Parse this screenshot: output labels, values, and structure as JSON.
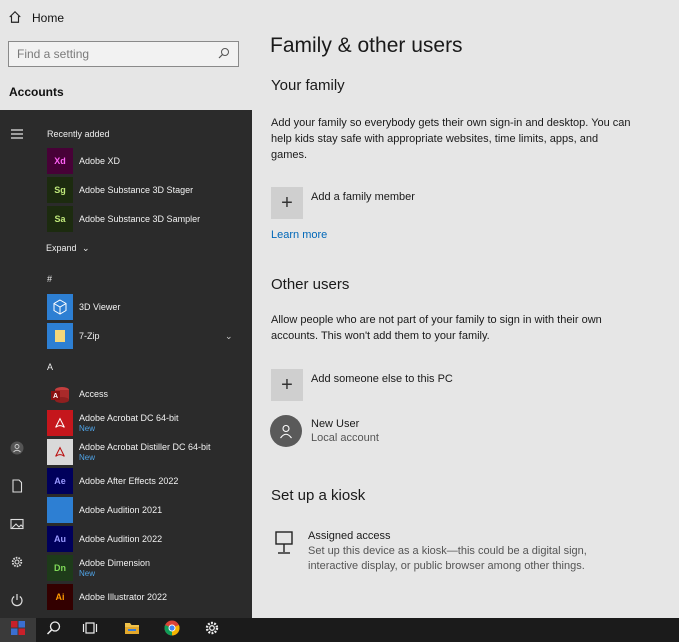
{
  "settings": {
    "home_label": "Home",
    "search_placeholder": "Find a setting",
    "section_label": "Accounts"
  },
  "start_menu": {
    "recently_added_label": "Recently added",
    "expand_label": "Expand",
    "hash_label": "#",
    "a_label": "A",
    "recent_apps": [
      {
        "name": "Adobe XD",
        "tile_text": "Xd",
        "tile_bg": "#470137",
        "tile_fg": "#ff61f6"
      },
      {
        "name": "Adobe Substance 3D Stager",
        "tile_text": "Sg",
        "tile_bg": "#1c2b0f",
        "tile_fg": "#bfe87a"
      },
      {
        "name": "Adobe Substance 3D Sampler",
        "tile_text": "Sa",
        "tile_bg": "#1c2b0f",
        "tile_fg": "#bfe87a"
      }
    ],
    "hash_apps": [
      {
        "name": "3D Viewer"
      },
      {
        "name": "7-Zip"
      }
    ],
    "a_apps": [
      {
        "name": "Access",
        "sub": ""
      },
      {
        "name": "Adobe Acrobat DC 64-bit",
        "sub": "New"
      },
      {
        "name": "Adobe Acrobat Distiller DC 64-bit",
        "sub": "New"
      },
      {
        "name": "Adobe After Effects 2022",
        "sub": "",
        "tile_text": "Ae"
      },
      {
        "name": "Adobe Audition 2021",
        "sub": ""
      },
      {
        "name": "Adobe Audition 2022",
        "sub": "",
        "tile_text": "Au"
      },
      {
        "name": "Adobe Dimension",
        "sub": "New",
        "tile_text": "Dn"
      },
      {
        "name": "Adobe Illustrator 2022",
        "sub": "",
        "tile_text": "Ai"
      }
    ]
  },
  "main": {
    "title": "Family & other users",
    "your_family": {
      "heading": "Your family",
      "description": "Add your family so everybody gets their own sign-in and desktop. You can help kids stay safe with appropriate websites, time limits, apps, and games.",
      "add_label": "Add a family member",
      "learn_more": "Learn more"
    },
    "other_users": {
      "heading": "Other users",
      "description": "Allow people who are not part of your family to sign in with their own accounts. This won't add them to your family.",
      "add_label": "Add someone else to this PC",
      "user_name": "New User",
      "user_type": "Local account"
    },
    "kiosk": {
      "heading": "Set up a kiosk",
      "title": "Assigned access",
      "description": "Set up this device as a kiosk—this could be a digital sign, interactive display, or public browser among other things."
    }
  }
}
